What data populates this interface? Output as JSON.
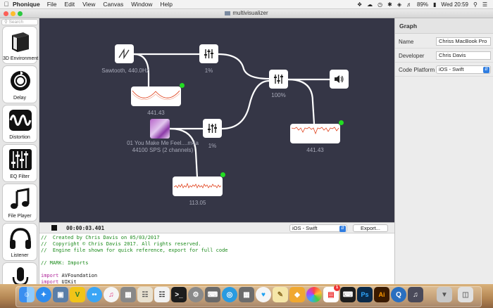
{
  "menubar": {
    "app_name": "Phonique",
    "items": [
      "File",
      "Edit",
      "View",
      "Canvas",
      "Window",
      "Help"
    ],
    "battery": "89%",
    "clock": "Wed 20:59"
  },
  "window": {
    "title": "multivisualizer"
  },
  "palette": {
    "search_placeholder": "Search",
    "tools": [
      {
        "label": "3D Environment",
        "icon": "cube-icon"
      },
      {
        "label": "Delay",
        "icon": "delay-icon"
      },
      {
        "label": "Distortion",
        "icon": "waveform-icon"
      },
      {
        "label": "EQ Filter",
        "icon": "eq-sliders-icon"
      },
      {
        "label": "File Player",
        "icon": "music-note-icon"
      },
      {
        "label": "Listener",
        "icon": "headphones-icon"
      },
      {
        "label": "",
        "icon": "microphone-icon"
      }
    ]
  },
  "canvas": {
    "sawtooth_caption": "Sawtooth, 440.0Hz",
    "mixer1_caption": "1%",
    "mixer_main_caption": "100%",
    "mixer2_caption": "1%",
    "scope1_value": "441.43",
    "scope2_value": "441.43",
    "scope3_value": "113.05",
    "file_caption_line1": "01 You Make Me Feel....m4a",
    "file_caption_line2": "44100 SPS (2 channels)"
  },
  "code_toolbar": {
    "timecode": "00:00:03.401",
    "platform": "iOS - Swift",
    "export_label": "Export..."
  },
  "code": {
    "lines": [
      {
        "kind": "cmt",
        "text": "//  Created by Chris Davis on 05/03/2017"
      },
      {
        "kind": "cmt",
        "text": "//  Copyright © Chris Davis 2017. All rights reserved."
      },
      {
        "kind": "cmt",
        "text": "//  Engine file shown for quick reference, export for full code"
      },
      {
        "kind": "plain",
        "text": ""
      },
      {
        "kind": "cmt",
        "text": "// MARK: Imports"
      },
      {
        "kind": "plain",
        "text": ""
      },
      {
        "kind": "import",
        "keyword": "import",
        "text": " AVFoundation"
      },
      {
        "kind": "import",
        "keyword": "import",
        "text": " UIKit"
      }
    ]
  },
  "inspector": {
    "header": "Graph",
    "name_label": "Name",
    "name_value": "Chriss MacBook Pro",
    "developer_label": "Developer",
    "developer_value": "Chris Davis",
    "platform_label": "Code Platform",
    "platform_value": "iOS - Swift"
  },
  "dock": {
    "icons": [
      "finder-icon",
      "safari-icon",
      "preview-icon",
      "vine-icon",
      "messages-icon",
      "itunes-icon",
      "photos-stack-icon",
      "books-icon",
      "terminal-icon",
      "settings-icon",
      "keyboard-icon",
      "network-icon",
      "twitter-icon",
      "notes-icon",
      "sketch-icon",
      "photos-icon",
      "calendar-icon",
      "photoshop-icon",
      "illustrator-icon",
      "quicktime-icon",
      "multivisualizer-icon",
      "downloads-icon",
      "trash-icon"
    ],
    "badge": "1"
  },
  "colors": {
    "canvas_bg": "#353646",
    "led_green": "#22dd22",
    "scope_wave": "#e0441f",
    "accent_blue": "#2f7de1"
  }
}
